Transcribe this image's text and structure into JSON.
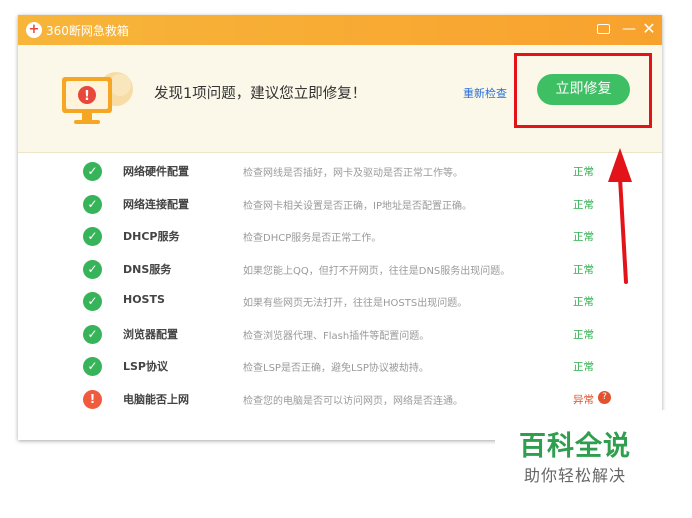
{
  "window": {
    "title": "360断网急救箱",
    "logo": "+"
  },
  "titlebar_buttons": {
    "feedback": "feedback-icon",
    "minimize": "—",
    "close": "✕"
  },
  "header": {
    "headline": "发现1项问题，建议您立即修复！",
    "recheck_label": "重新检查",
    "fix_label": "立即修复",
    "warn_symbol": "!"
  },
  "items": [
    {
      "name": "网络硬件配置",
      "desc": "检查网线是否插好，网卡及驱动是否正常工作等。",
      "status": "正常",
      "icon": "✓"
    },
    {
      "name": "网络连接配置",
      "desc": "检查网卡相关设置是否正确，IP地址是否配置正确。",
      "status": "正常",
      "icon": "✓"
    },
    {
      "name": "DHCP服务",
      "desc": "检查DHCP服务是否正常工作。",
      "status": "正常",
      "icon": "✓"
    },
    {
      "name": "DNS服务",
      "desc": "如果您能上QQ，但打不开网页，往往是DNS服务出现问题。",
      "status": "正常",
      "icon": "✓"
    },
    {
      "name": "HOSTS",
      "desc": "如果有些网页无法打开，往往是HOSTS出现问题。",
      "status": "正常",
      "icon": "✓"
    },
    {
      "name": "浏览器配置",
      "desc": "检查浏览器代理、Flash插件等配置问题。",
      "status": "正常",
      "icon": "✓"
    },
    {
      "name": "LSP协议",
      "desc": "检查LSP是否正确，避免LSP协议被劫持。",
      "status": "正常",
      "icon": "✓"
    },
    {
      "name": "电脑能否上网",
      "desc": "检查您的电脑是否可以访问网页，网络是否连通。",
      "status": "异常",
      "icon": "!",
      "help": "?"
    }
  ],
  "watermark": {
    "title": "百科全说",
    "subtitle": "助你轻松解决"
  },
  "colors": {
    "titlebar": "#f8a22e",
    "ok": "#37b35a",
    "error": "#ef5b3c",
    "highlight": "#e2141a"
  }
}
